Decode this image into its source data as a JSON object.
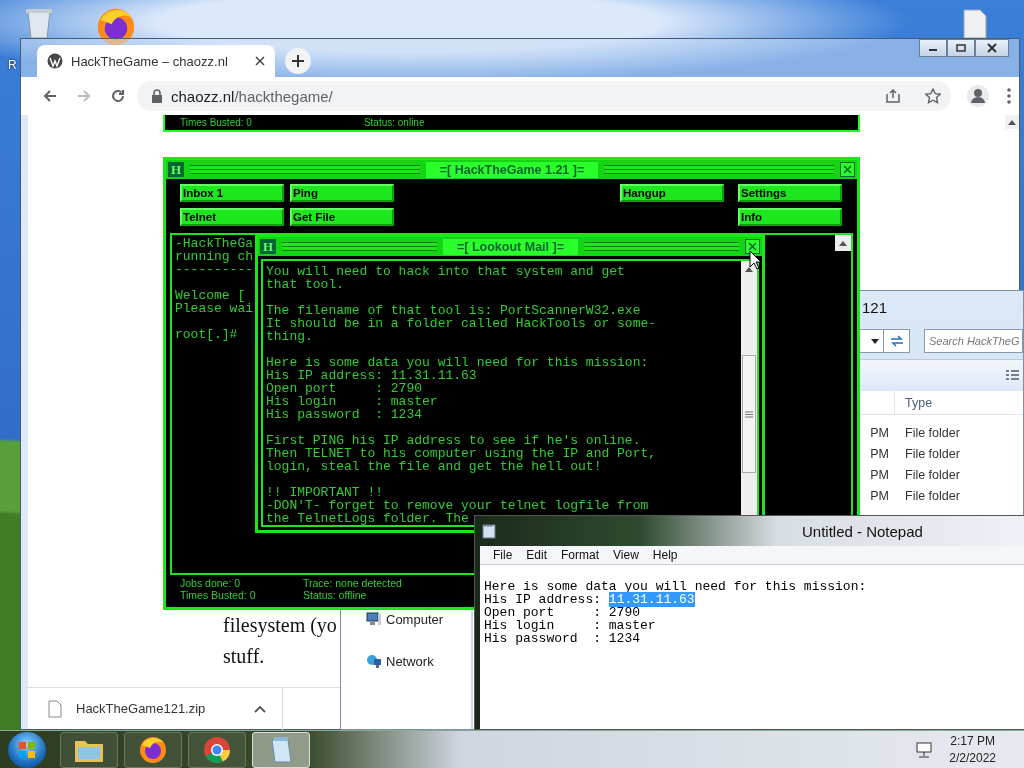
{
  "desktop": {
    "icon_labels": [
      "R"
    ]
  },
  "browser": {
    "tabs": [
      {
        "title": "HackTheGame – chaozz.nl",
        "selected": true
      }
    ],
    "nav_buttons": [
      {
        "kind": "back",
        "disabled": false
      },
      {
        "kind": "forward",
        "disabled": true
      },
      {
        "kind": "reload",
        "disabled": false
      }
    ],
    "address": {
      "host": "chaozz.nl",
      "path": "/hackthegame/"
    },
    "page": {
      "game_strip": {
        "times_busted": "Times Busted: 0",
        "status": "Status: online"
      },
      "paragraph_lines": [
        "filesystem (yo",
        "stuff."
      ]
    },
    "download": {
      "file": "HackTheGame121.zip"
    }
  },
  "explorer": {
    "title": "121",
    "search": {
      "placeholder": "Search HackTheG"
    },
    "columns": [
      "Type"
    ],
    "rows": [
      {
        "column_1": "PM",
        "type": "File folder"
      },
      {
        "column_1": "PM",
        "type": "File folder"
      },
      {
        "column_1": "PM",
        "type": "File folder"
      },
      {
        "column_1": "PM",
        "type": "File folder"
      }
    ],
    "nav_items": [
      {
        "kind": "computer",
        "label": "Computer"
      },
      {
        "kind": "network",
        "label": "Network"
      }
    ]
  },
  "game": {
    "icon_text": "H",
    "title": "=[ HackTheGame 1.21 ]=",
    "button_rows": [
      {
        "left": [
          "Inbox 1",
          "Ping"
        ],
        "right": [
          "Hangup",
          "Settings"
        ]
      },
      {
        "left": [
          "Telnet",
          "Get File"
        ],
        "right": [
          "Info"
        ]
      }
    ],
    "terminal": [
      [
        "-HackTheGa",
        "running ch",
        "----------"
      ],
      [
        "Welcome [",
        "Please wai"
      ],
      [
        "root[.]#"
      ]
    ],
    "status_left": [
      "Jobs done: 0",
      "Times Busted: 0"
    ],
    "status_right": [
      "Trace: none detected",
      "Status: offline"
    ]
  },
  "mail": {
    "icon_text": "H",
    "title": "=[ Lookout Mail ]=",
    "paragraphs": [
      [
        "You will need to hack into that system and get",
        "that tool."
      ],
      [
        "The filename of that tool is: PortScannerW32.exe",
        "It should be in a folder called HackTools or some-",
        "thing."
      ],
      [
        "Here is some data you will need for this mission:",
        "His IP address: 11.31.11.63",
        "Open port     : 2790",
        "His login     : master",
        "His password  : 1234"
      ],
      [
        "First PING his IP address to see if he's online.",
        "Then TELNET to his computer using the IP and Port,",
        "login, steal the file and get the hell out!"
      ],
      [
        "!! IMPORTANT !!",
        "-DON'T- forget to remove your telnet logfile from",
        "the TelnetLogs folder. The"
      ]
    ]
  },
  "notepad": {
    "title": "Untitled - Notepad",
    "menu": [
      "File",
      "Edit",
      "Format",
      "View",
      "Help"
    ],
    "lines": [
      {
        "text": "Here is some data you will need for this mission:"
      },
      {
        "text": "His IP address: ",
        "selection": "11.31.11.63"
      },
      {
        "text": "Open port     : 2790"
      },
      {
        "text": "His login     : master"
      },
      {
        "text": "His password  : 1234"
      }
    ]
  },
  "taskbar": {
    "apps": [
      {
        "kind": "explorer",
        "active": false
      },
      {
        "kind": "firefox",
        "active": false
      },
      {
        "kind": "chrome",
        "active": false
      },
      {
        "kind": "notepad",
        "active": true
      }
    ],
    "clock": {
      "time": "2:17 PM",
      "date": "2/2/2022"
    }
  }
}
